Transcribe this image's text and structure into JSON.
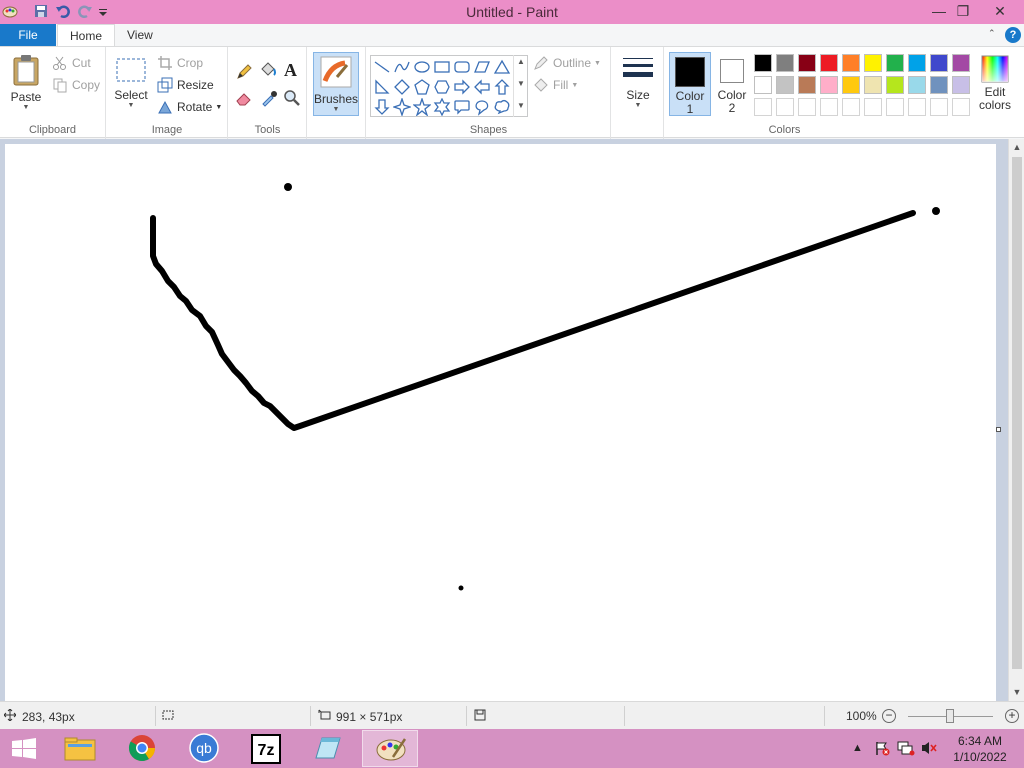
{
  "window": {
    "title": "Untitled - Paint"
  },
  "tabs": {
    "file": "File",
    "home": "Home",
    "view": "View"
  },
  "ribbon": {
    "clipboard": {
      "label": "Clipboard",
      "paste": "Paste",
      "cut": "Cut",
      "copy": "Copy"
    },
    "image": {
      "label": "Image",
      "select": "Select",
      "crop": "Crop",
      "resize": "Resize",
      "rotate": "Rotate"
    },
    "tools": {
      "label": "Tools",
      "text_tool": "A"
    },
    "brushes": {
      "label": "Brushes"
    },
    "shapes": {
      "label": "Shapes",
      "outline": "Outline",
      "fill": "Fill"
    },
    "size": {
      "label": "Size"
    },
    "colors": {
      "label": "Colors",
      "color1": "Color 1",
      "color1_line1": "Color",
      "color1_line2": "1",
      "color2_line1": "Color",
      "color2_line2": "2",
      "edit_line1": "Edit",
      "edit_line2": "colors",
      "color1_value": "#000000",
      "color2_value": "#ffffff",
      "palette_row1": [
        "#000000",
        "#7f7f7f",
        "#880015",
        "#ed1c24",
        "#ff7f27",
        "#fff200",
        "#22b14c",
        "#00a2e8",
        "#3f48cc",
        "#a349a4"
      ],
      "palette_row2": [
        "#ffffff",
        "#c3c3c3",
        "#b97a57",
        "#ffaec9",
        "#ffc90e",
        "#efe4b0",
        "#b5e61d",
        "#99d9ea",
        "#7092be",
        "#c8bfe7"
      ],
      "palette_row3": [
        "#ffffff",
        "#ffffff",
        "#ffffff",
        "#ffffff",
        "#ffffff",
        "#ffffff",
        "#ffffff",
        "#ffffff",
        "#ffffff",
        "#ffffff"
      ]
    }
  },
  "status": {
    "cursor_pos": "283, 43px",
    "canvas_size": "991 × 571px",
    "zoom": "100%"
  },
  "taskbar": {
    "apps": [
      "windows-start",
      "file-explorer",
      "chrome",
      "qbittorrent",
      "7zip",
      "notepad",
      "paint"
    ],
    "time": "6:34 AM",
    "date": "1/10/2022"
  }
}
